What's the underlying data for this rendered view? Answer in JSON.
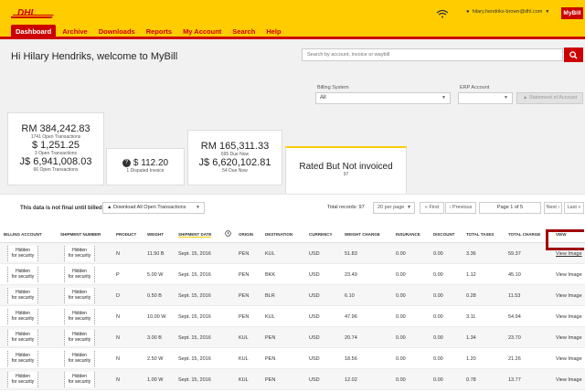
{
  "header": {
    "nav": [
      "Dashboard",
      "Archive",
      "Downloads",
      "Reports",
      "My Account",
      "Search",
      "Help"
    ],
    "user_email": "hilary.hendriks-brown@dhl.com",
    "mybill_label": "MyBill",
    "colors": {
      "brand_yellow": "#ffcc00",
      "brand_red": "#cc0000"
    }
  },
  "welcome": "Hi Hilary Hendriks, welcome to MyBill",
  "search": {
    "placeholder": "Search by account, invoice or waybill"
  },
  "filters": {
    "billing_label": "Billing System",
    "billing_value": "All",
    "erp_label": "ERP Account",
    "erp_value": "",
    "statement_label": "Statement of Account"
  },
  "cards": {
    "open": {
      "line1": "RM 384,242.83",
      "line1_sub": "1741 Open Transactions",
      "line2": "$ 1,251.25",
      "line2_sub": "3 Open Transactions",
      "line3": "J$ 6,941,008.03",
      "line3_sub": "66 Open Transactions"
    },
    "disputed": {
      "amount": "$ 112.20",
      "sub": "1 Disputed Invoice"
    },
    "due": {
      "line1": "RM 165,311.33",
      "line1_sub": "695 Due Now",
      "line2": "J$ 6,620,102.81",
      "line2_sub": "54 Due Now"
    },
    "rated": {
      "title": "Rated But Not invoiced",
      "count": "97"
    }
  },
  "toolbar": {
    "note": "This data is not final until billed.",
    "download_label": "Download All Open Transactions",
    "records_label": "Total records: 97",
    "per_page": "20 per page",
    "first": "« First",
    "previous": "‹ Previous",
    "page_of": "Page 1 of 5",
    "next": "Next ›",
    "last": "Last »"
  },
  "table": {
    "columns": [
      "Billing Account",
      "Shipment Number",
      "Product",
      "Weight",
      "Shipment Date",
      "Origin",
      "Destination",
      "Currency",
      "Weight Charge",
      "Insurance",
      "Discount",
      "Total Taxes",
      "Total Charge",
      "View"
    ],
    "hidden_label": [
      "Hidden",
      "for security"
    ],
    "view_label": "View Image",
    "rows": [
      [
        "N",
        "11.50 B",
        "Sept. 15, 2016",
        "PEN",
        "KUL",
        "USD",
        "51.83",
        "0.00",
        "0.00",
        "3.36",
        "59.37"
      ],
      [
        "P",
        "5.00 W",
        "Sept. 15, 2016",
        "PEN",
        "BKK",
        "USD",
        "23.49",
        "0.00",
        "0.00",
        "1.12",
        "45.10"
      ],
      [
        "D",
        "0.50 B",
        "Sept. 15, 2016",
        "PEN",
        "BLR",
        "USD",
        "6.10",
        "0.00",
        "0.00",
        "0.28",
        "11.53"
      ],
      [
        "N",
        "10.00 W",
        "Sept. 15, 2016",
        "PEN",
        "KUL",
        "USD",
        "47.96",
        "0.00",
        "0.00",
        "3.11",
        "54.94"
      ],
      [
        "N",
        "3.00 B",
        "Sept. 15, 2016",
        "KUL",
        "PEN",
        "USD",
        "20.74",
        "0.00",
        "0.00",
        "1.34",
        "23.70"
      ],
      [
        "N",
        "2.50 W",
        "Sept. 15, 2016",
        "KUL",
        "PEN",
        "USD",
        "18.56",
        "0.00",
        "0.00",
        "1.20",
        "21.26"
      ],
      [
        "N",
        "1.00 W",
        "Sept. 15, 2016",
        "KUL",
        "PEN",
        "USD",
        "12.02",
        "0.00",
        "0.00",
        "0.78",
        "13.77"
      ]
    ]
  }
}
